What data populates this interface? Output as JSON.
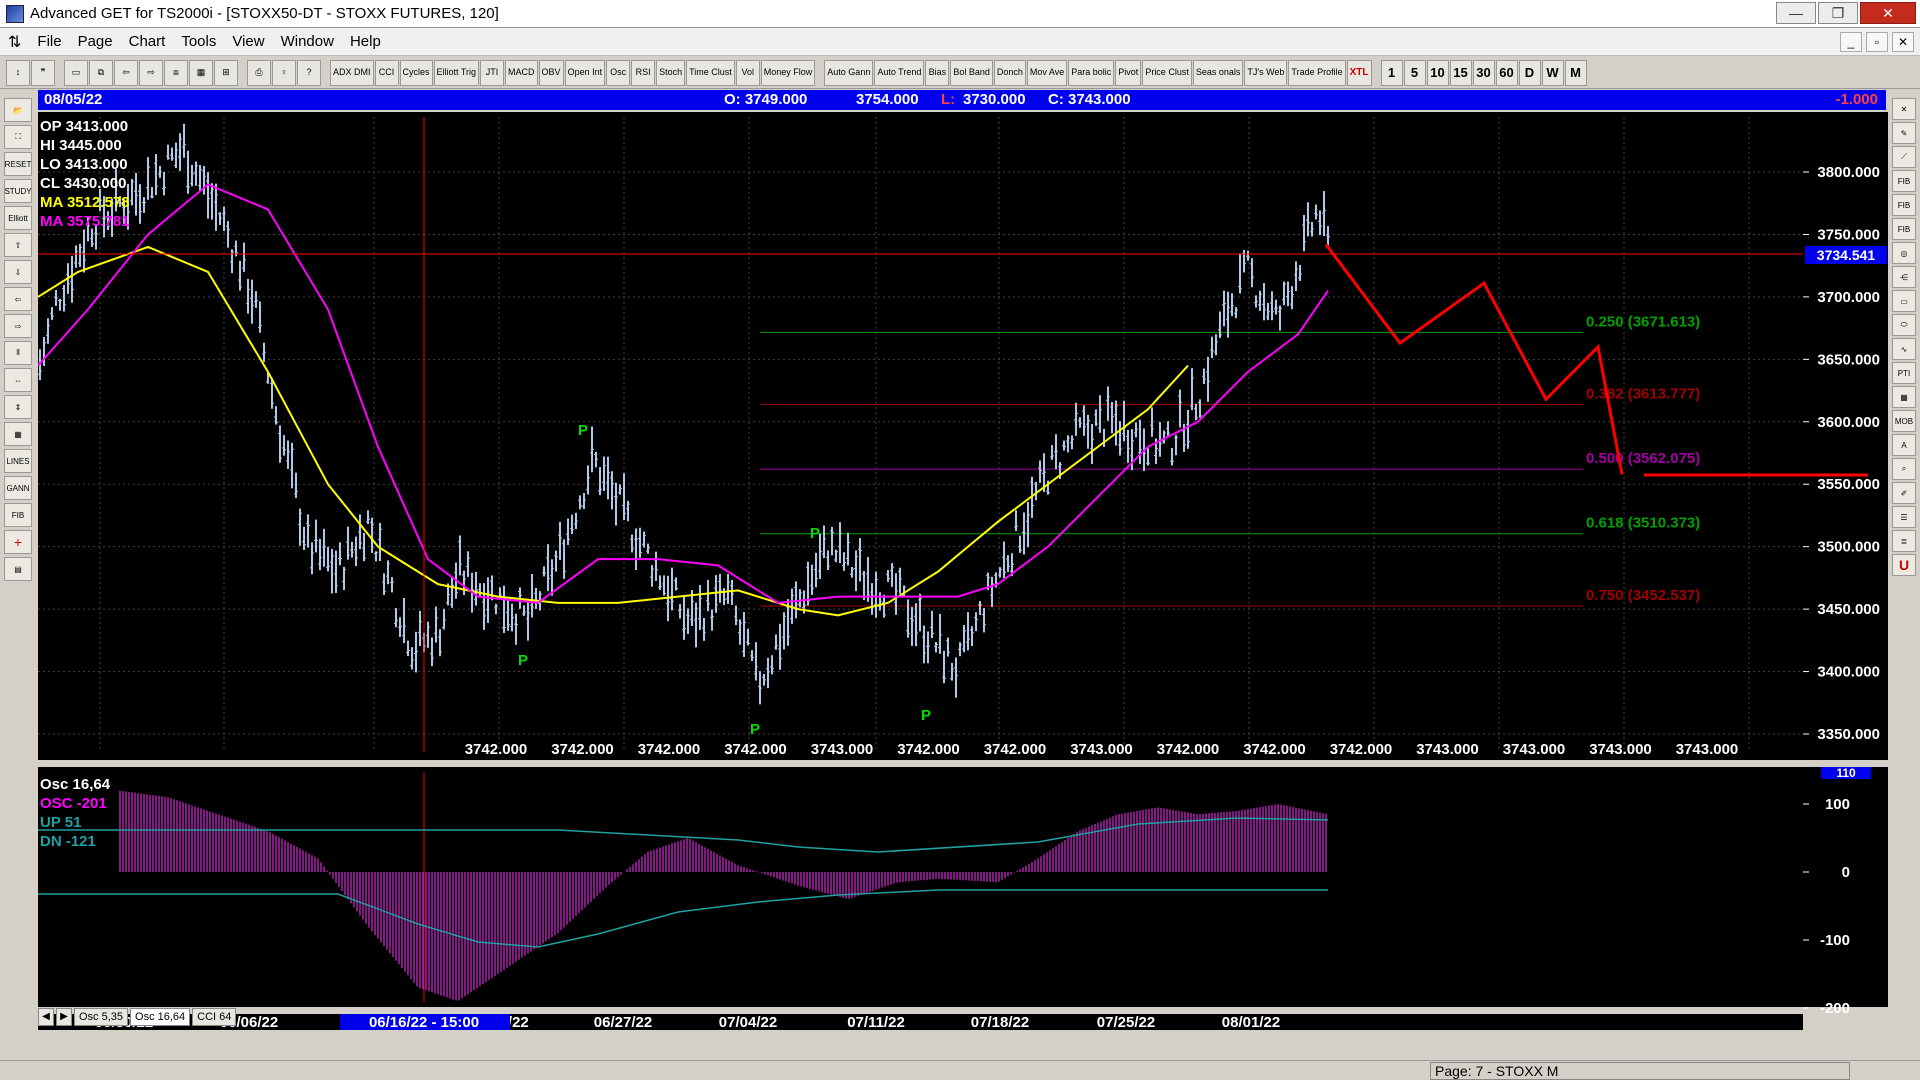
{
  "window": {
    "title": "Advanced GET for TS2000i - [STOXX50-DT - STOXX FUTURES, 120]",
    "min_label": "—",
    "max_label": "❐",
    "close_label": "✕"
  },
  "menu": {
    "items": [
      "File",
      "Page",
      "Chart",
      "Tools",
      "View",
      "Window",
      "Help"
    ],
    "mdi": [
      "_",
      "▫",
      "✕"
    ]
  },
  "toolbar": {
    "indicators": [
      "ADX DMI",
      "CCI",
      "Cycles",
      "Elliott Trig",
      "JTI",
      "MACD",
      "OBV",
      "Open Int",
      "Osc",
      "RSI",
      "Stoch",
      "Time Clust",
      "Vol",
      "Money Flow",
      "Auto Gann",
      "Auto Trend",
      "Bias",
      "Bol Band",
      "Donch",
      "Mov Ave",
      "Para bolic",
      "Pivot",
      "Price Clust",
      "Seas onals",
      "TJ's Web",
      "Trade Profile",
      "XTL"
    ],
    "timeframes": [
      "1",
      "5",
      "10",
      "15",
      "30",
      "60",
      "D",
      "W",
      "M"
    ]
  },
  "info": {
    "date": "08/05/22",
    "open": "O: 3749.000",
    "high": "3754.000",
    "low_label": "L:",
    "low": "3730.000",
    "close": "C: 3743.000",
    "change": "-1.000"
  },
  "legend": {
    "op": "OP 3413.000",
    "hi": "HI   3445.000",
    "lo": "LO  3413.000",
    "cl": "CL  3430.000",
    "ma1": "MA  3512.578",
    "ma2": "MA  3575.781"
  },
  "osc_legend": {
    "title": "Osc 16,64",
    "osc": "OSC -201",
    "up": "UP    51",
    "dn": "DN   -121"
  },
  "colors": {
    "bg": "#000000",
    "bars": "#b0c8e8",
    "ma_fast": "#ffff00",
    "ma_slow": "#ff00ff",
    "projection": "#ff0000",
    "fib_green": "#00a000",
    "fib_red": "#a00000",
    "fib_purple": "#a000a0",
    "pivot": "#00dd00",
    "osc_hist": "#b020b0",
    "osc_line": "#20a0a0"
  },
  "price_axis": {
    "ticks": [
      "3800.000",
      "3750.000",
      "3700.000",
      "3650.000",
      "3600.000",
      "3550.000",
      "3500.000",
      "3450.000",
      "3400.000",
      "3350.000"
    ],
    "current_price": "3734.541"
  },
  "osc_axis": {
    "ticks": [
      "100",
      "0",
      "-100",
      "-200"
    ],
    "top_value": "110"
  },
  "fib_levels": [
    {
      "label": "0.250 (3671.613)",
      "price": 3671.613,
      "color": "#00a000"
    },
    {
      "label": "0.382 (3613.777)",
      "price": 3613.777,
      "color": "#a00000"
    },
    {
      "label": "0.500 (3562.075)",
      "price": 3562.075,
      "color": "#a000a0"
    },
    {
      "label": "0.618 (3510.373)",
      "price": 3510.373,
      "color": "#00a000"
    },
    {
      "label": "0.750 (3452.537)",
      "price": 3452.537,
      "color": "#a00000"
    }
  ],
  "bottom_values": [
    "3742.000",
    "3742.000",
    "3742.000",
    "3742.000",
    "3743.000",
    "3742.000",
    "3742.000",
    "3743.000",
    "3742.000",
    "3742.000",
    "3742.000",
    "3743.000",
    "3743.000",
    "3743.000",
    "3743.000"
  ],
  "pivots": [
    "P",
    "P",
    "P",
    "P",
    "P",
    "P"
  ],
  "date_axis": {
    "labels": [
      "05/30/22",
      "06/06/22",
      "06",
      "20/22",
      "06/27/22",
      "07/04/22",
      "07/11/22",
      "07/18/22",
      "07/25/22",
      "08/01/22"
    ],
    "cursor_label": "06/16/22 - 15:00"
  },
  "osc_tabs": [
    "Osc 5,35",
    "Osc 16,64",
    "CCI 64"
  ],
  "status": {
    "page": "Page: 7 - STOXX M"
  }
}
